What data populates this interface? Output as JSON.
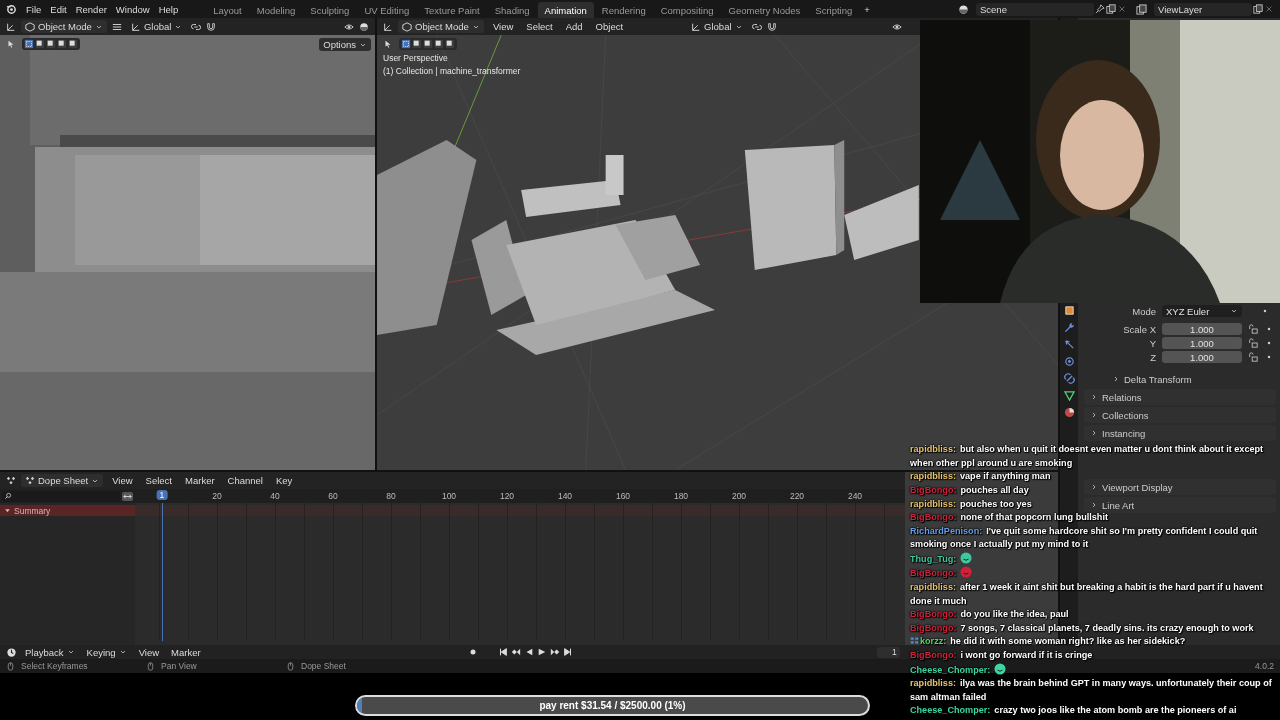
{
  "topbar": {
    "menus": [
      "File",
      "Edit",
      "Render",
      "Window",
      "Help"
    ],
    "workspaces": [
      {
        "label": "Layout",
        "selected": false
      },
      {
        "label": "Modeling",
        "selected": false
      },
      {
        "label": "Sculpting",
        "selected": false
      },
      {
        "label": "UV Editing",
        "selected": false
      },
      {
        "label": "Texture Paint",
        "selected": false
      },
      {
        "label": "Shading",
        "selected": false
      },
      {
        "label": "Animation",
        "selected": true
      },
      {
        "label": "Rendering",
        "selected": false
      },
      {
        "label": "Compositing",
        "selected": false
      },
      {
        "label": "Geometry Nodes",
        "selected": false
      },
      {
        "label": "Scripting",
        "selected": false
      }
    ],
    "add_workspace": "+",
    "scene": "Scene",
    "view_layer": "ViewLayer"
  },
  "left_viewport": {
    "mode": "Object Mode",
    "orientation": "Global",
    "options": "Options"
  },
  "center_viewport": {
    "mode": "Object Mode",
    "menus": [
      "View",
      "Select",
      "Add",
      "Object"
    ],
    "orientation": "Global",
    "overlay_lines": [
      "User Perspective",
      "(1) Collection | machine_transformer"
    ]
  },
  "properties": {
    "rotation_mode_label": "Mode",
    "rotation_mode": "XYZ Euler",
    "scale": [
      {
        "label": "Scale X",
        "value": "1.000"
      },
      {
        "label": "Y",
        "value": "1.000"
      },
      {
        "label": "Z",
        "value": "1.000"
      }
    ],
    "subpanel": "Delta Transform",
    "sections": [
      {
        "kind": "panel",
        "label": "Relations"
      },
      {
        "kind": "panel",
        "label": "Collections"
      },
      {
        "kind": "panel",
        "label": "Instancing"
      },
      {
        "kind": "covered"
      },
      {
        "kind": "covered"
      },
      {
        "kind": "panel",
        "label": "Viewport Display"
      },
      {
        "kind": "panel",
        "label": "Line Art"
      },
      {
        "kind": "covered"
      }
    ]
  },
  "dope_sheet": {
    "editor": "Dope Sheet",
    "menus": [
      "View",
      "Select",
      "Marker",
      "Channel",
      "Key"
    ],
    "current_frame": "1",
    "ruler": [
      "20",
      "40",
      "60",
      "80",
      "100",
      "120",
      "140",
      "160",
      "180",
      "200",
      "220",
      "240"
    ],
    "channels": [
      {
        "label": "Summary",
        "expanded": true
      }
    ]
  },
  "timeline": {
    "dropdown_menus": [
      "Playback",
      "Keying"
    ],
    "menus": [
      "View",
      "Marker"
    ],
    "frame": "1"
  },
  "status_bar": {
    "hints": [
      "Select Keyframes",
      "Pan View",
      "Dope Sheet"
    ],
    "version": "4.0.2"
  },
  "chat": [
    {
      "name": "rapidbliss:",
      "color": "#e8c36a",
      "badge": false,
      "kind": "text",
      "text": "but also when u quit it doesnt even matter u dont think about it except when other ppl around u are smoking"
    },
    {
      "name": "rapidbliss:",
      "color": "#e8c36a",
      "badge": false,
      "kind": "text",
      "text": "vape if anything man"
    },
    {
      "name": "BigBongo:",
      "color": "#d0213c",
      "badge": false,
      "kind": "text",
      "text": "pouches all day"
    },
    {
      "name": "rapidbliss:",
      "color": "#e8c36a",
      "badge": false,
      "kind": "text",
      "text": "pouches too yes"
    },
    {
      "name": "BigBongo:",
      "color": "#d0213c",
      "badge": false,
      "kind": "text",
      "text": "none of that popcorn lung bullshit"
    },
    {
      "name": "RichardPenison:",
      "color": "#6a9de8",
      "badge": false,
      "kind": "text",
      "text": "I've quit some hardcore shit so I'm pretty confident I could quit smoking once I actually put my mind to it"
    },
    {
      "name": "Thug_Tug:",
      "color": "#3cc9a0",
      "badge": false,
      "kind": "emote"
    },
    {
      "name": "BigBongo:",
      "color": "#d0213c",
      "badge": false,
      "kind": "emote"
    },
    {
      "name": "rapidbliss:",
      "color": "#e8c36a",
      "badge": false,
      "kind": "text",
      "text": "after 1 week it aint shit but breaking a habit is the hard part if u havent done it much"
    },
    {
      "name": "BigBongo:",
      "color": "#d0213c",
      "badge": false,
      "kind": "text",
      "text": "do you like the idea, paul"
    },
    {
      "name": "BigBongo:",
      "color": "#d0213c",
      "badge": false,
      "kind": "text",
      "text": "7 songs, 7 classical planets, 7 deadly sins. its crazy enough to work"
    },
    {
      "name": "korzz:",
      "color": "#52d66a",
      "badge": true,
      "kind": "text",
      "text": "he did it with some woman right? like as her sidekick?"
    },
    {
      "name": "BigBongo:",
      "color": "#d0213c",
      "badge": false,
      "kind": "text",
      "text": "i wont go forward if it is cringe"
    },
    {
      "name": "Cheese_Chomper:",
      "color": "#3cd6a0",
      "badge": false,
      "kind": "emote"
    },
    {
      "name": "rapidbliss:",
      "color": "#e8c36a",
      "badge": false,
      "kind": "text",
      "text": "ilya was the brain behind GPT in many ways. unfortunately their coup of sam altman failed"
    },
    {
      "name": "Cheese_Chomper:",
      "color": "#3cd6a0",
      "badge": false,
      "kind": "text",
      "text": "crazy two joos like the atom bomb are the pioneers of ai"
    }
  ],
  "donation": {
    "text": "pay rent $31.54 / $2500.00 (1%)",
    "level": 0.01
  }
}
